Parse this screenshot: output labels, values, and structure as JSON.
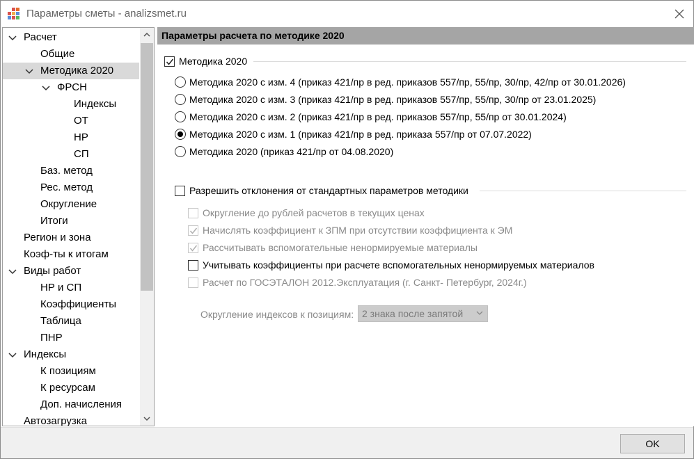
{
  "window": {
    "title": "Параметры сметы - analizsmet.ru",
    "app_icon": "table-app-icon",
    "close_icon": "close-icon"
  },
  "tree": {
    "items": [
      {
        "label": "Расчет",
        "level": 0,
        "expandable": true,
        "expanded": true
      },
      {
        "label": "Общие",
        "level": 1
      },
      {
        "label": "Методика 2020",
        "level": 1,
        "expandable": true,
        "expanded": true,
        "selected": true
      },
      {
        "label": "ФРСН",
        "level": 2,
        "expandable": true,
        "expanded": true
      },
      {
        "label": "Индексы",
        "level": 3
      },
      {
        "label": "ОТ",
        "level": 3
      },
      {
        "label": "НР",
        "level": 3
      },
      {
        "label": "СП",
        "level": 3
      },
      {
        "label": "Баз. метод",
        "level": 1
      },
      {
        "label": "Рес. метод",
        "level": 1
      },
      {
        "label": "Округление",
        "level": 1
      },
      {
        "label": "Итоги",
        "level": 1
      },
      {
        "label": "Регион и зона",
        "level": 0
      },
      {
        "label": "Коэф-ты к итогам",
        "level": 0
      },
      {
        "label": "Виды работ",
        "level": 0,
        "expandable": true,
        "expanded": true
      },
      {
        "label": "НР и СП",
        "level": 1
      },
      {
        "label": "Коэффициенты",
        "level": 1
      },
      {
        "label": "Таблица",
        "level": 1
      },
      {
        "label": "ПНР",
        "level": 1
      },
      {
        "label": "Индексы",
        "level": 0,
        "expandable": true,
        "expanded": true
      },
      {
        "label": "К позициям",
        "level": 1
      },
      {
        "label": "К ресурсам",
        "level": 1
      },
      {
        "label": "Доп. начисления",
        "level": 1
      },
      {
        "label": "Автозагрузка",
        "level": 0
      }
    ]
  },
  "main": {
    "header": "Параметры расчета по методике 2020",
    "methodology_checkbox": {
      "label": "Методика 2020",
      "checked": true
    },
    "radios": [
      {
        "label": "Методика 2020 с изм. 4 (приказ 421/пр в ред. приказов 557/пр, 55/пр, 30/пр, 42/пр от 30.01.2026)",
        "checked": false
      },
      {
        "label": "Методика 2020 с изм. 3 (приказ 421/пр в ред. приказов 557/пр, 55/пр, 30/пр от 23.01.2025)",
        "checked": false
      },
      {
        "label": "Методика 2020 с изм. 2 (приказ 421/пр в ред. приказов 557/пр, 55/пр от 30.01.2024)",
        "checked": false
      },
      {
        "label": "Методика 2020 с изм. 1 (приказ 421/пр в ред. приказа 557/пр от 07.07.2022)",
        "checked": true
      },
      {
        "label": "Методика 2020 (приказ 421/пр от 04.08.2020)",
        "checked": false
      }
    ],
    "deviation_checkbox": {
      "label": "Разрешить отклонения от стандартных параметров методики",
      "checked": false
    },
    "options": [
      {
        "label": "Округление до рублей расчетов в текущих ценах",
        "checked": false,
        "enabled": false
      },
      {
        "label": "Начислять коэффициент к ЗПМ при отсутствии коэффициента к ЭМ",
        "checked": true,
        "enabled": false
      },
      {
        "label": "Рассчитывать вспомогательные ненормируемые материалы",
        "checked": true,
        "enabled": false
      },
      {
        "label": "Учитывать коэффициенты при расчете вспомогательных ненормируемых материалов",
        "checked": false,
        "enabled": true
      },
      {
        "label": "Расчет по ГОСЭТАЛОН 2012.Эксплуатация (г. Санкт- Петербург, 2024г.)",
        "checked": false,
        "enabled": false
      }
    ],
    "rounding": {
      "label": "Округление индексов к позициям:",
      "value": "2 знака после запятой",
      "enabled": false
    }
  },
  "footer": {
    "ok_label": "OK"
  },
  "colors": {
    "header_bg": "#a5a5a5",
    "selected_bg": "#d9d9d9",
    "disabled_text": "#8a8a8a"
  }
}
